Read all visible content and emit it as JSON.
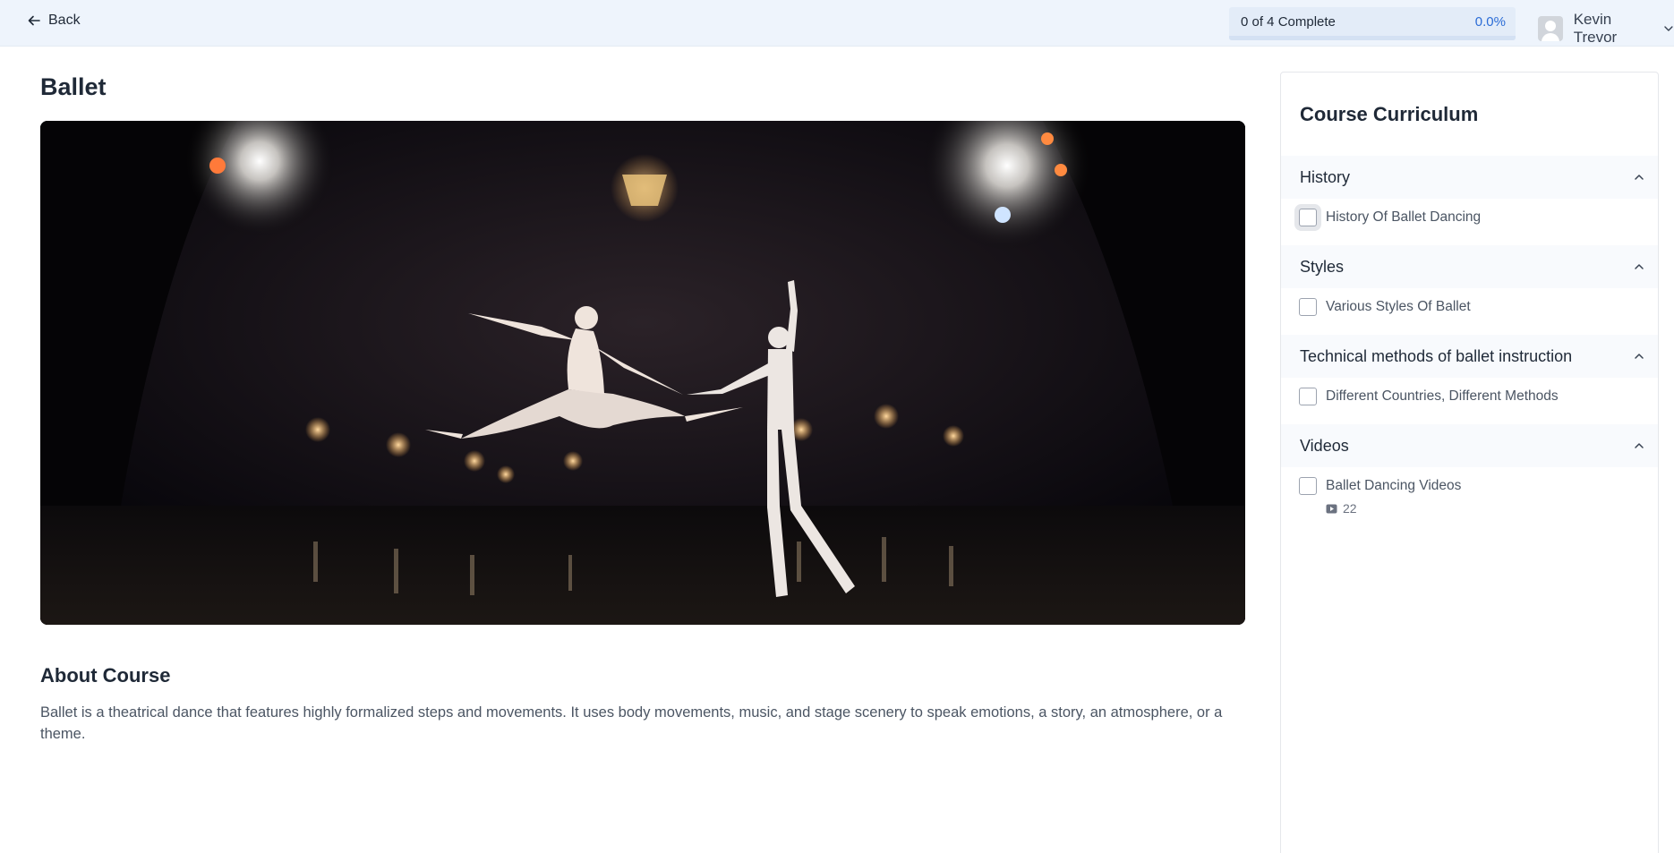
{
  "header": {
    "back_label": "Back",
    "progress": {
      "label": "0 of 4 Complete",
      "percent_text": "0.0%",
      "value": 0.0
    },
    "user_name": "Kevin Trevor"
  },
  "course": {
    "title": "Ballet",
    "about_heading": "About Course",
    "about_text": "Ballet is a theatrical dance that features highly formalized steps and movements. It uses body movements, music, and stage scenery to speak emotions, a story, an atmosphere, or a theme."
  },
  "curriculum": {
    "title": "Course Curriculum",
    "sections": [
      {
        "name": "History",
        "lessons": [
          {
            "label": "History Of Ballet Dancing",
            "checked": false
          }
        ]
      },
      {
        "name": "Styles",
        "lessons": [
          {
            "label": "Various Styles Of Ballet",
            "checked": false
          }
        ]
      },
      {
        "name": "Technical methods of ballet instruction",
        "lessons": [
          {
            "label": "Different Countries, Different Methods",
            "checked": false
          }
        ]
      },
      {
        "name": "Videos",
        "lessons": [
          {
            "label": "Ballet Dancing Videos",
            "checked": false,
            "meta": "22"
          }
        ]
      }
    ]
  },
  "colors": {
    "accent": "#2b6cd6",
    "header_bg": "#eef4fc",
    "section_bg": "#f8fafd"
  },
  "icons": [
    "arrow-left-icon",
    "chevron-down-icon",
    "chevron-up-icon",
    "video-icon",
    "avatar"
  ]
}
